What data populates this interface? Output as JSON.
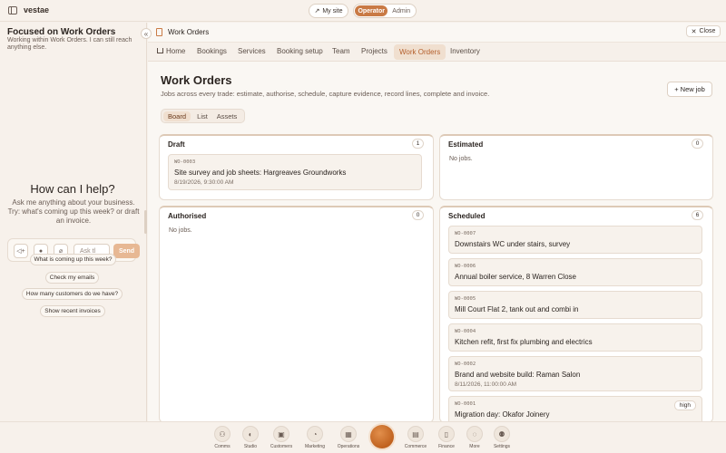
{
  "app": {
    "brand": "vestae",
    "my_site": "My site",
    "roles": [
      "Operator",
      "Admin"
    ],
    "active_role": "Operator"
  },
  "assistant": {
    "focus_title": "Focused on Work Orders",
    "focus_sub": "Working within Work Orders. I can still reach anything else.",
    "help_title": "How can I help?",
    "help_sub": "Ask me anything about your business. Try: what's coming up this week? or draft an invoice.",
    "input_placeholder": "Ask tl",
    "send_label": "Send",
    "suggestions": [
      "What is coming up this week?",
      "Check my emails",
      "How many customers do we have?",
      "Show recent invoices"
    ]
  },
  "header": {
    "breadcrumb": "Work Orders",
    "close_label": "Close"
  },
  "tabs": [
    "Home",
    "Bookings",
    "Services",
    "Booking setup",
    "Team",
    "Projects",
    "Work Orders",
    "Inventory"
  ],
  "active_tab": "Work Orders",
  "page": {
    "title": "Work Orders",
    "subtitle": "Jobs across every trade: estimate, authorise, schedule, capture evidence, record lines, complete and invoice.",
    "new_job": "+ New job",
    "views": [
      "Board",
      "List",
      "Assets"
    ],
    "active_view": "Board"
  },
  "columns": {
    "draft": {
      "title": "Draft",
      "count": "1",
      "cards": [
        {
          "id": "WO-0003",
          "title": "Site survey and job sheets: Hargreaves Groundworks",
          "date": "8/19/2026, 9:30:00 AM"
        }
      ]
    },
    "estimated": {
      "title": "Estimated",
      "count": "0",
      "empty": "No jobs."
    },
    "authorised": {
      "title": "Authorised",
      "count": "0",
      "empty": "No jobs."
    },
    "scheduled": {
      "title": "Scheduled",
      "count": "6",
      "cards": [
        {
          "id": "WO-0007",
          "title": "Downstairs WC under stairs, survey"
        },
        {
          "id": "WO-0006",
          "title": "Annual boiler service, 8 Warren Close"
        },
        {
          "id": "WO-0005",
          "title": "Mill Court Flat 2, tank out and combi in"
        },
        {
          "id": "WO-0004",
          "title": "Kitchen refit, first fix plumbing and electrics"
        },
        {
          "id": "WO-0002",
          "title": "Brand and website build: Raman Salon",
          "date": "8/11/2026, 11:00:00 AM"
        },
        {
          "id": "WO-0001",
          "title": "Migration day: Okafor Joinery",
          "badge": "high"
        }
      ]
    }
  },
  "dock": [
    {
      "label": "Comms",
      "icon": "people-icon"
    },
    {
      "label": "Studio",
      "icon": "palette-icon"
    },
    {
      "label": "Customers",
      "icon": "contact-card-icon"
    },
    {
      "label": "Marketing",
      "icon": "megaphone-icon"
    },
    {
      "label": "Operations",
      "icon": "calendar-icon"
    },
    {
      "label": "Commerce",
      "icon": "store-icon"
    },
    {
      "label": "Finance",
      "icon": "document-icon"
    },
    {
      "label": "More",
      "icon": "chat-icon"
    },
    {
      "label": "Settings",
      "icon": "settings-people-icon"
    }
  ],
  "colors": {
    "accent": "#c97a45",
    "background": "#f6f0ea",
    "panel": "#ffffff"
  }
}
